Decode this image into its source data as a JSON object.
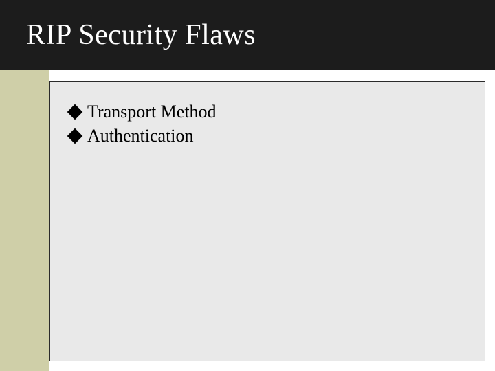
{
  "slide": {
    "title": "RIP Security Flaws",
    "bullets": [
      {
        "label": "Transport Method"
      },
      {
        "label": "Authentication"
      }
    ]
  },
  "colors": {
    "title_bar_bg": "#1c1c1c",
    "sidebar_bg": "#cfcfa8",
    "panel_bg": "#e9e9e9",
    "bullet_fill": "#000000"
  }
}
